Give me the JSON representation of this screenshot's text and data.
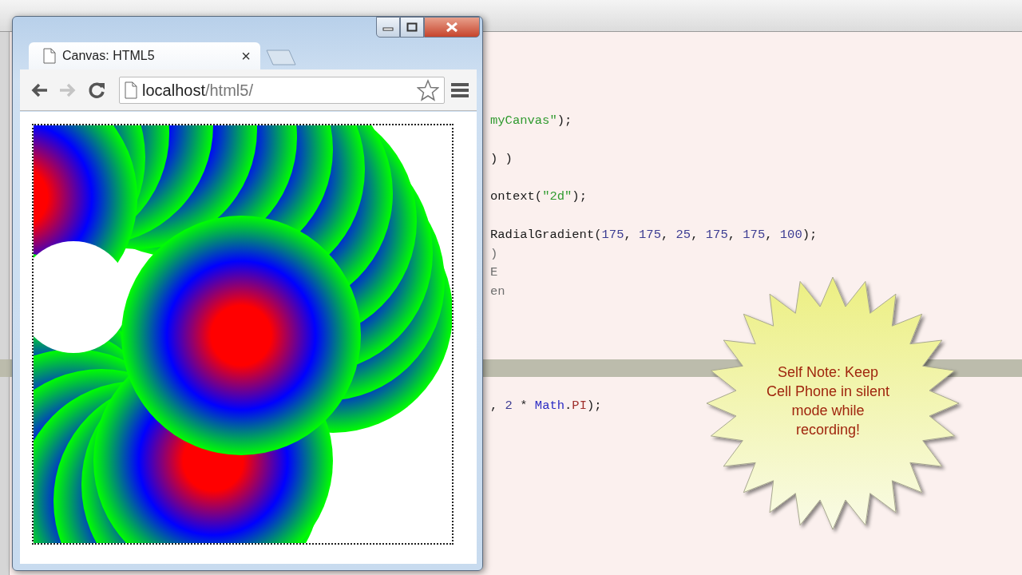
{
  "editor": {
    "lines": [
      {
        "segments": [
          {
            "kind": "string",
            "text": "myCanvas\""
          },
          {
            "kind": "plain",
            "text": ");"
          }
        ]
      },
      {
        "segments": [
          {
            "kind": "plain",
            "text": ") )"
          }
        ]
      },
      {
        "segments": [
          {
            "kind": "plain",
            "text": "ontext("
          },
          {
            "kind": "string",
            "text": "\"2d\""
          },
          {
            "kind": "plain",
            "text": ");"
          }
        ]
      },
      {
        "segments": [
          {
            "kind": "plain",
            "text": "RadialGradient("
          },
          {
            "kind": "number",
            "text": "175"
          },
          {
            "kind": "plain",
            "text": ", "
          },
          {
            "kind": "number",
            "text": "175"
          },
          {
            "kind": "plain",
            "text": ", "
          },
          {
            "kind": "number",
            "text": "25"
          },
          {
            "kind": "plain",
            "text": ", "
          },
          {
            "kind": "number",
            "text": "175"
          },
          {
            "kind": "plain",
            "text": ", "
          },
          {
            "kind": "number",
            "text": "175"
          },
          {
            "kind": "plain",
            "text": ", "
          },
          {
            "kind": "number",
            "text": "100"
          },
          {
            "kind": "plain",
            "text": ");"
          }
        ]
      },
      {
        "segments": [
          {
            "kind": "comment",
            "text": ")"
          }
        ]
      },
      {
        "segments": [
          {
            "kind": "comment",
            "text": "E"
          }
        ]
      },
      {
        "segments": [
          {
            "kind": "comment",
            "text": "en"
          }
        ]
      },
      {
        "segments": [
          {
            "kind": "plain",
            "text": ", "
          },
          {
            "kind": "number",
            "text": "2"
          },
          {
            "kind": "plain",
            "text": " * "
          },
          {
            "kind": "keyword",
            "text": "Math"
          },
          {
            "kind": "plain",
            "text": "."
          },
          {
            "kind": "constant",
            "text": "PI"
          },
          {
            "kind": "plain",
            "text": ");"
          }
        ]
      }
    ]
  },
  "browser": {
    "tab": {
      "title": "Canvas: HTML5",
      "close": "×"
    },
    "nav": [
      {
        "kind": "back",
        "disabled": false
      },
      {
        "kind": "forward",
        "disabled": true
      },
      {
        "kind": "reload",
        "disabled": false
      }
    ],
    "url": {
      "host": "localhost",
      "path": "/html5/"
    }
  },
  "note": {
    "text": "Self Note: Keep Cell Phone in silent mode while recording!"
  }
}
